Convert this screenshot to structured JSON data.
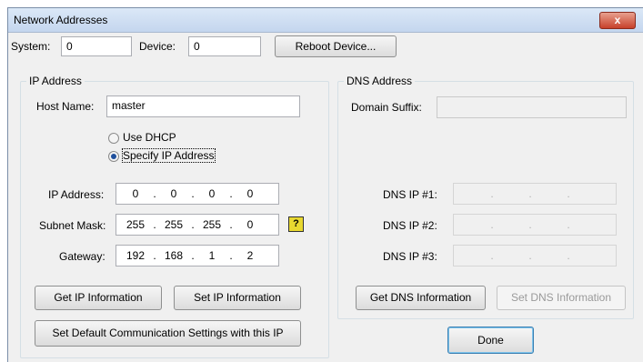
{
  "window": {
    "title": "Network Addresses",
    "close_label": "x"
  },
  "top": {
    "system_label": "System:",
    "system_value": "0",
    "device_label": "Device:",
    "device_value": "0",
    "reboot_label": "Reboot Device..."
  },
  "ip_group": {
    "title": "IP Address",
    "host_label": "Host Name:",
    "host_value": "master",
    "dhcp_label": "Use DHCP",
    "specify_label": "Specify IP Address",
    "selected": "specify",
    "ip_label": "IP Address:",
    "ip": [
      "0",
      "0",
      "0",
      "0"
    ],
    "mask_label": "Subnet Mask:",
    "mask": [
      "255",
      "255",
      "255",
      "0"
    ],
    "gw_label": "Gateway:",
    "gw": [
      "192",
      "168",
      "1",
      "2"
    ],
    "help_glyph": "?",
    "get_label": "Get IP Information",
    "set_label": "Set IP Information",
    "default_label": "Set Default Communication Settings with this IP"
  },
  "dns_group": {
    "title": "DNS Address",
    "suffix_label": "Domain Suffix:",
    "suffix_value": "",
    "dns1_label": "DNS IP #1:",
    "dns2_label": "DNS IP #2:",
    "dns3_label": "DNS IP #3:",
    "get_label": "Get DNS Information",
    "set_label": "Set DNS Information"
  },
  "done_label": "Done",
  "colors": {
    "title_bar": "#c4d6ee",
    "close": "#c7412a",
    "help_icon": "#e8d830",
    "dialog": "#f0f0f0"
  }
}
